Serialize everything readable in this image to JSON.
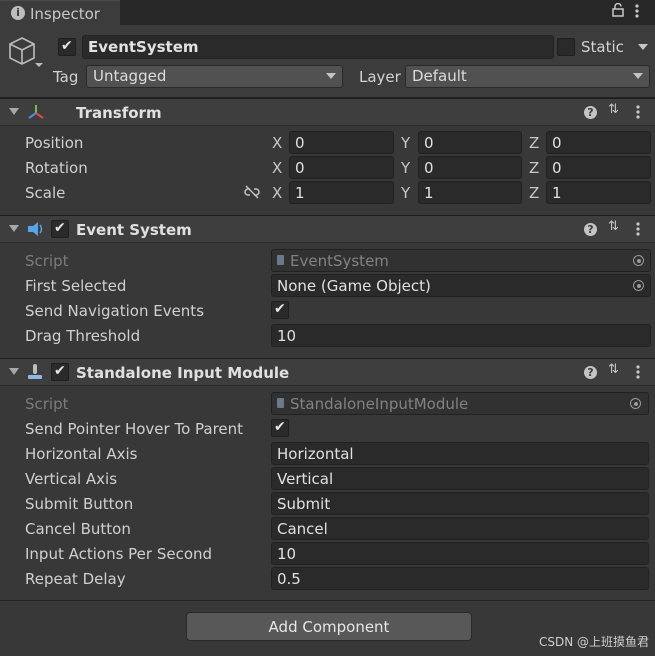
{
  "tab": {
    "label": "Inspector"
  },
  "object": {
    "name": "EventSystem",
    "active": true,
    "static_label": "Static",
    "tag_label": "Tag",
    "tag_value": "Untagged",
    "layer_label": "Layer",
    "layer_value": "Default"
  },
  "transform": {
    "title": "Transform",
    "rows": [
      {
        "label": "Position",
        "x": "0",
        "y": "0",
        "z": "0"
      },
      {
        "label": "Rotation",
        "x": "0",
        "y": "0",
        "z": "0"
      },
      {
        "label": "Scale",
        "x": "1",
        "y": "1",
        "z": "1"
      }
    ],
    "axis": {
      "x": "X",
      "y": "Y",
      "z": "Z"
    }
  },
  "event_system": {
    "title": "Event System",
    "enabled": true,
    "script_label": "Script",
    "script_value": "EventSystem",
    "first_selected_label": "First Selected",
    "first_selected_value": "None (Game Object)",
    "send_nav_label": "Send Navigation Events",
    "send_nav_checked": true,
    "drag_threshold_label": "Drag Threshold",
    "drag_threshold_value": "10"
  },
  "input_module": {
    "title": "Standalone Input Module",
    "enabled": true,
    "script_label": "Script",
    "script_value": "StandaloneInputModule",
    "hover_label": "Send Pointer Hover To Parent",
    "hover_checked": true,
    "horizontal_label": "Horizontal Axis",
    "horizontal_value": "Horizontal",
    "vertical_label": "Vertical Axis",
    "vertical_value": "Vertical",
    "submit_label": "Submit Button",
    "submit_value": "Submit",
    "cancel_label": "Cancel Button",
    "cancel_value": "Cancel",
    "ips_label": "Input Actions Per Second",
    "ips_value": "10",
    "repeat_label": "Repeat Delay",
    "repeat_value": "0.5"
  },
  "add_component_label": "Add Component",
  "watermark": "CSDN @上班摸鱼君",
  "colors": {
    "background": "#383838",
    "header": "#3e3e3e",
    "field": "#2a2a2a"
  }
}
